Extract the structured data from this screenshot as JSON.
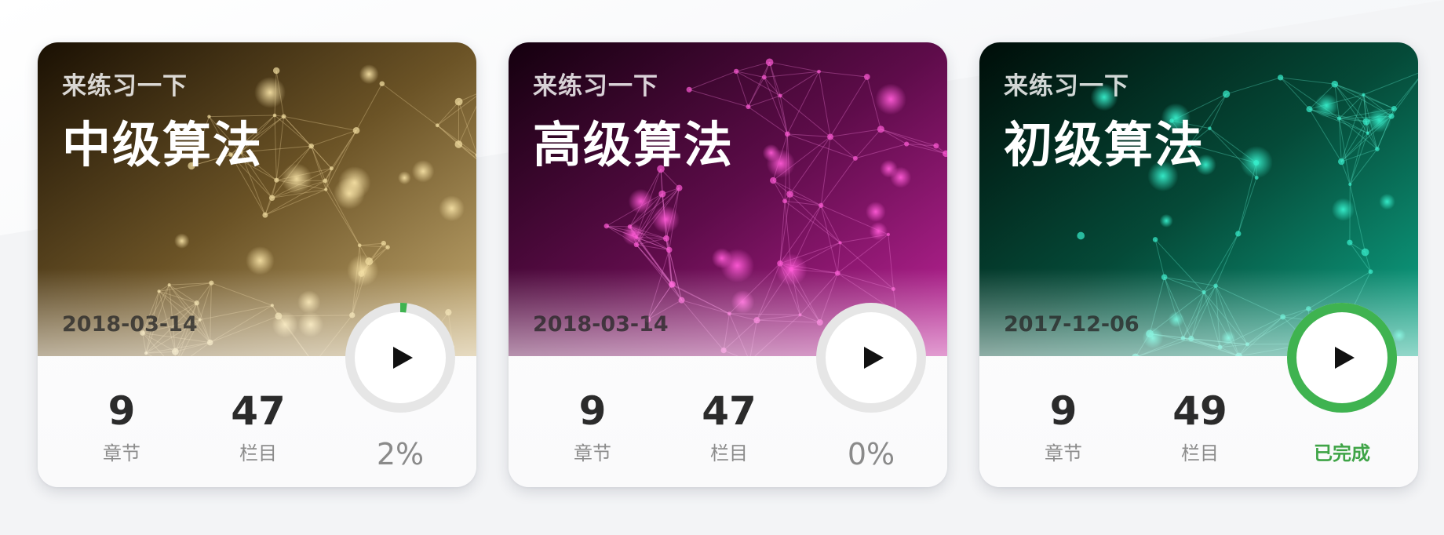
{
  "colors": {
    "progress_green": "#3fb350",
    "progress_track": "#e6e6e6",
    "done_text": "#3fa447"
  },
  "icons": {
    "play": "play-icon"
  },
  "cards": [
    {
      "theme": "gold",
      "subtitle": "来练习一下",
      "title": "中级算法",
      "date": "2018-03-14",
      "chapters": "9",
      "chapters_label": "章节",
      "columns": "47",
      "columns_label": "栏目",
      "progress": 0.02,
      "progress_text": "2%",
      "completed": false
    },
    {
      "theme": "magenta",
      "subtitle": "来练习一下",
      "title": "高级算法",
      "date": "2018-03-14",
      "chapters": "9",
      "chapters_label": "章节",
      "columns": "47",
      "columns_label": "栏目",
      "progress": 0.0,
      "progress_text": "0%",
      "completed": false
    },
    {
      "theme": "teal",
      "subtitle": "来练习一下",
      "title": "初级算法",
      "date": "2017-12-06",
      "chapters": "9",
      "chapters_label": "章节",
      "columns": "49",
      "columns_label": "栏目",
      "progress": 1.0,
      "progress_text": "已完成",
      "completed": true
    }
  ]
}
